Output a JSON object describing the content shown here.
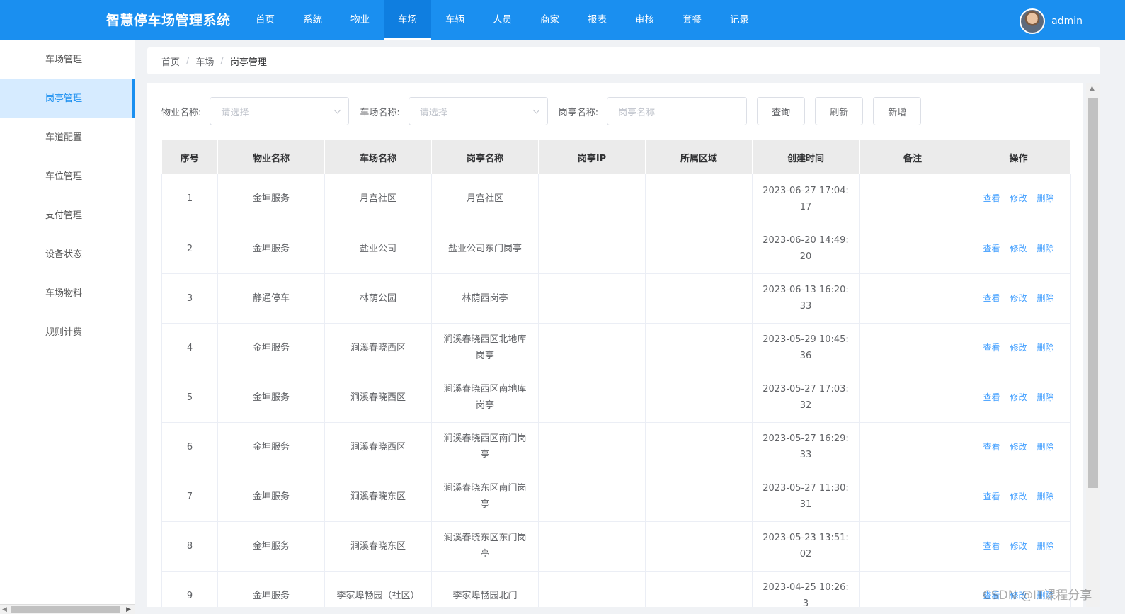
{
  "header": {
    "brand": "智慧停车场管理系统",
    "nav": [
      "首页",
      "系统",
      "物业",
      "车场",
      "车辆",
      "人员",
      "商家",
      "报表",
      "审核",
      "套餐",
      "记录"
    ],
    "active_nav": 3,
    "username": "admin"
  },
  "sidebar": {
    "items": [
      "车场管理",
      "岗亭管理",
      "车道配置",
      "车位管理",
      "支付管理",
      "设备状态",
      "车场物料",
      "规则计费"
    ],
    "active": 1
  },
  "breadcrumb": [
    "首页",
    "车场",
    "岗亭管理"
  ],
  "filters": {
    "property_label": "物业名称:",
    "property_placeholder": "请选择",
    "lot_label": "车场名称:",
    "lot_placeholder": "请选择",
    "booth_label": "岗亭名称:",
    "booth_placeholder": "岗亭名称",
    "buttons": {
      "query": "查询",
      "refresh": "刷新",
      "add": "新增"
    }
  },
  "table": {
    "columns": [
      "序号",
      "物业名称",
      "车场名称",
      "岗亭名称",
      "岗亭IP",
      "所属区域",
      "创建时间",
      "备注",
      "操作"
    ],
    "row_actions": [
      "查看",
      "修改",
      "删除"
    ],
    "rows": [
      [
        "1",
        "金坤服务",
        "月宫社区",
        "月宫社区",
        "",
        "",
        "2023-06-27 17:04:17",
        ""
      ],
      [
        "2",
        "金坤服务",
        "盐业公司",
        "盐业公司东门岗亭",
        "",
        "",
        "2023-06-20 14:49:20",
        ""
      ],
      [
        "3",
        "静通停车",
        "林荫公园",
        "林荫西岗亭",
        "",
        "",
        "2023-06-13 16:20:33",
        ""
      ],
      [
        "4",
        "金坤服务",
        "涧溪春晓西区",
        "涧溪春晓西区北地库岗亭",
        "",
        "",
        "2023-05-29 10:45:36",
        ""
      ],
      [
        "5",
        "金坤服务",
        "涧溪春晓西区",
        "涧溪春晓西区南地库岗亭",
        "",
        "",
        "2023-05-27 17:03:32",
        ""
      ],
      [
        "6",
        "金坤服务",
        "涧溪春晓西区",
        "涧溪春晓西区南门岗亭",
        "",
        "",
        "2023-05-27 16:29:33",
        ""
      ],
      [
        "7",
        "金坤服务",
        "涧溪春晓东区",
        "涧溪春晓东区南门岗亭",
        "",
        "",
        "2023-05-27 11:30:31",
        ""
      ],
      [
        "8",
        "金坤服务",
        "涧溪春晓东区",
        "涧溪春晓东区东门岗亭",
        "",
        "",
        "2023-05-23 13:51:02",
        ""
      ],
      [
        "9",
        "金坤服务",
        "李家埠畅园（社区）",
        "李家埠畅园北门",
        "",
        "",
        "2023-04-25 10:26:3",
        ""
      ]
    ]
  },
  "watermark": "CSDN @IT课程分享"
}
